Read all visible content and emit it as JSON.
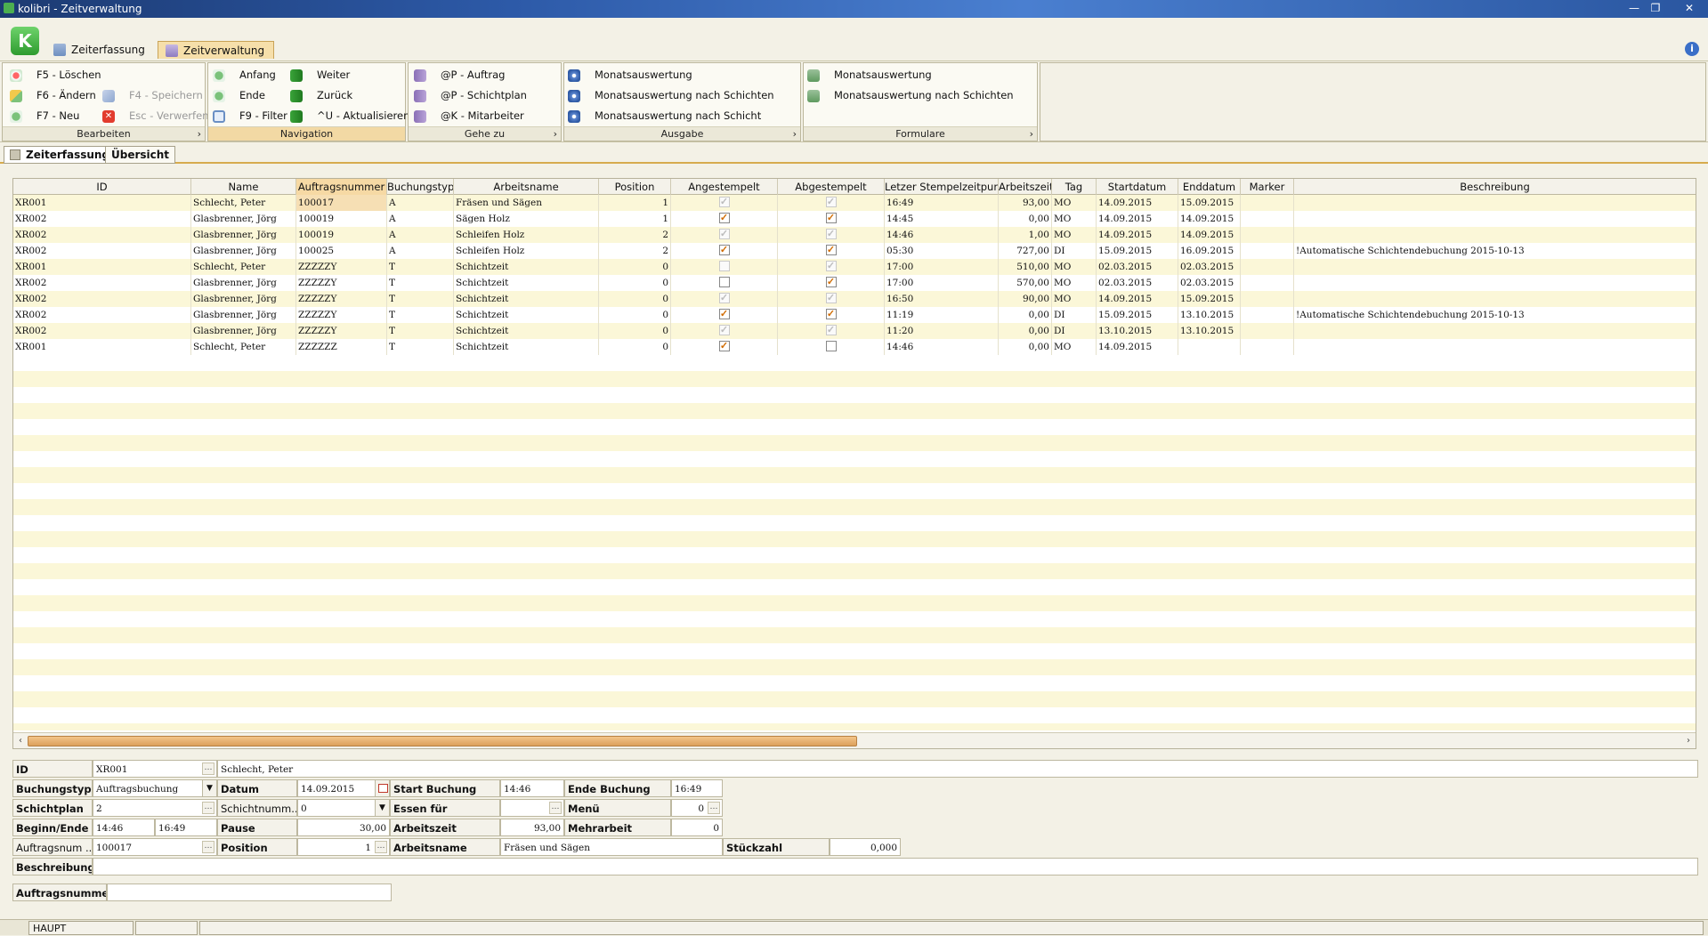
{
  "window": {
    "title": "kolibri - Zeitverwaltung",
    "controls": [
      "—",
      "❐",
      "✕"
    ]
  },
  "tabs": {
    "zeiterfassung": "Zeiterfassung",
    "zeitverwaltung": "Zeitverwaltung"
  },
  "ribbon": {
    "bearbeiten": {
      "footer": "Bearbeiten",
      "delete": "F5 - Löschen",
      "edit": "F6 - Ändern",
      "new": "F7 - Neu",
      "save": "F4 - Speichern",
      "discard": "Esc - Verwerfen"
    },
    "navigation": {
      "footer": "Navigation",
      "start": "Anfang",
      "end": "Ende",
      "filter": "F9 - Filter",
      "next": "Weiter",
      "back": "Zurück",
      "refresh": "^U - Aktualisieren"
    },
    "gehezu": {
      "footer": "Gehe zu",
      "order": "@P - Auftrag",
      "shiftplan": "@P - Schichtplan",
      "employee": "@K - Mitarbeiter"
    },
    "ausgabe": {
      "footer": "Ausgabe",
      "monthly": "Monatsauswertung",
      "monthly_shifts": "Monatsauswertung nach Schichten",
      "monthly_shift": "Monatsauswertung nach Schicht"
    },
    "formulare": {
      "footer": "Formulare",
      "monthly": "Monatsauswertung",
      "monthly_shifts": "Monatsauswertung nach Schichten"
    }
  },
  "subtabs": {
    "zeiterfassung": "Zeiterfassung",
    "uebersicht": "Übersicht"
  },
  "grid": {
    "columns": [
      "ID",
      "Name",
      "Auftragsnummer",
      "Buchungstyp",
      "Arbeitsname",
      "Position",
      "Angestempelt",
      "Abgestempelt",
      "Letzer Stempelzeitpunkt",
      "Arbeitszeit",
      "Tag",
      "Startdatum",
      "Enddatum",
      "Marker",
      "Beschreibung"
    ],
    "rows": [
      {
        "id": "XR001",
        "name": "Schlecht, Peter",
        "order": "100017",
        "type": "A",
        "work": "Fräsen und Sägen",
        "pos": "1",
        "in": true,
        "in_dim": true,
        "out": true,
        "out_dim": true,
        "last": "16:49",
        "hours": "93,00",
        "day": "MO",
        "start": "14.09.2015",
        "end": "15.09.2015",
        "marker": "",
        "desc": ""
      },
      {
        "id": "XR002",
        "name": "Glasbrenner, Jörg",
        "order": "100019",
        "type": "A",
        "work": "Sägen Holz",
        "pos": "1",
        "in": true,
        "in_dim": false,
        "out": true,
        "out_dim": false,
        "last": "14:45",
        "hours": "0,00",
        "day": "MO",
        "start": "14.09.2015",
        "end": "14.09.2015",
        "marker": "",
        "desc": ""
      },
      {
        "id": "XR002",
        "name": "Glasbrenner, Jörg",
        "order": "100019",
        "type": "A",
        "work": "Schleifen Holz",
        "pos": "2",
        "in": true,
        "in_dim": true,
        "out": true,
        "out_dim": true,
        "last": "14:46",
        "hours": "1,00",
        "day": "MO",
        "start": "14.09.2015",
        "end": "14.09.2015",
        "marker": "",
        "desc": ""
      },
      {
        "id": "XR002",
        "name": "Glasbrenner, Jörg",
        "order": "100025",
        "type": "A",
        "work": "Schleifen Holz",
        "pos": "2",
        "in": true,
        "in_dim": false,
        "out": true,
        "out_dim": false,
        "last": "05:30",
        "hours": "727,00",
        "day": "DI",
        "start": "15.09.2015",
        "end": "16.09.2015",
        "marker": "",
        "desc": "!Automatische Schichtendebuchung 2015-10-13"
      },
      {
        "id": "XR001",
        "name": "Schlecht, Peter",
        "order": "ZZZZZY",
        "type": "T",
        "work": "Schichtzeit",
        "pos": "0",
        "in": false,
        "in_dim": true,
        "out": true,
        "out_dim": true,
        "last": "17:00",
        "hours": "510,00",
        "day": "MO",
        "start": "02.03.2015",
        "end": "02.03.2015",
        "marker": "",
        "desc": ""
      },
      {
        "id": "XR002",
        "name": "Glasbrenner, Jörg",
        "order": "ZZZZZY",
        "type": "T",
        "work": "Schichtzeit",
        "pos": "0",
        "in": false,
        "in_dim": false,
        "out": true,
        "out_dim": false,
        "last": "17:00",
        "hours": "570,00",
        "day": "MO",
        "start": "02.03.2015",
        "end": "02.03.2015",
        "marker": "",
        "desc": ""
      },
      {
        "id": "XR002",
        "name": "Glasbrenner, Jörg",
        "order": "ZZZZZY",
        "type": "T",
        "work": "Schichtzeit",
        "pos": "0",
        "in": true,
        "in_dim": true,
        "out": true,
        "out_dim": true,
        "last": "16:50",
        "hours": "90,00",
        "day": "MO",
        "start": "14.09.2015",
        "end": "15.09.2015",
        "marker": "",
        "desc": ""
      },
      {
        "id": "XR002",
        "name": "Glasbrenner, Jörg",
        "order": "ZZZZZY",
        "type": "T",
        "work": "Schichtzeit",
        "pos": "0",
        "in": true,
        "in_dim": false,
        "out": true,
        "out_dim": false,
        "last": "11:19",
        "hours": "0,00",
        "day": "DI",
        "start": "15.09.2015",
        "end": "13.10.2015",
        "marker": "",
        "desc": "!Automatische Schichtendebuchung 2015-10-13"
      },
      {
        "id": "XR002",
        "name": "Glasbrenner, Jörg",
        "order": "ZZZZZY",
        "type": "T",
        "work": "Schichtzeit",
        "pos": "0",
        "in": true,
        "in_dim": true,
        "out": true,
        "out_dim": true,
        "last": "11:20",
        "hours": "0,00",
        "day": "DI",
        "start": "13.10.2015",
        "end": "13.10.2015",
        "marker": "",
        "desc": ""
      },
      {
        "id": "XR001",
        "name": "Schlecht, Peter",
        "order": "ZZZZZZ",
        "type": "T",
        "work": "Schichtzeit",
        "pos": "0",
        "in": true,
        "in_dim": false,
        "out": false,
        "out_dim": false,
        "last": "14:46",
        "hours": "0,00",
        "day": "MO",
        "start": "14.09.2015",
        "end": "",
        "marker": "",
        "desc": ""
      }
    ]
  },
  "form": {
    "id_label": "ID",
    "id_value": "XR001",
    "id_name": "Schlecht, Peter",
    "buchungstyp_label": "Buchungstyp",
    "buchungstyp_value": "Auftragsbuchung",
    "datum_label": "Datum",
    "datum_value": "14.09.2015",
    "start_label": "Start Buchung",
    "start_value": "14:46",
    "ende_label": "Ende Buchung",
    "ende_value": "16:49",
    "schichtplan_label": "Schichtplan",
    "schichtplan_value": "2",
    "schichtnummer_label": "Schichtnumm...",
    "schichtnummer_value": "0",
    "essen_label": "Essen für",
    "essen_value": "",
    "menu_label": "Menü",
    "menu_value": "0",
    "beginn_label": "Beginn/Ende",
    "beginn_value": "14:46",
    "beginn_end_value": "16:49",
    "pause_label": "Pause",
    "pause_value": "30,00",
    "arbeitszeit_label": "Arbeitszeit",
    "arbeitszeit_value": "93,00",
    "mehrarbeit_label": "Mehrarbeit",
    "mehrarbeit_value": "0",
    "auftragsnum_label": "Auftragsnum ...",
    "auftragsnum_value": "100017",
    "position_label": "Position",
    "position_value": "1",
    "arbeitsname_label": "Arbeitsname",
    "arbeitsname_value": "Fräsen und Sägen",
    "stueckzahl_label": "Stückzahl",
    "stueckzahl_value": "0,000",
    "beschreibung_label": "Beschreibung",
    "beschreibung_value": "",
    "auftragsnummer_label": "Auftragsnummer",
    "auftragsnummer_value": ""
  },
  "status": {
    "panel1": "HAUPT",
    "panel2": "",
    "panel3": ""
  }
}
